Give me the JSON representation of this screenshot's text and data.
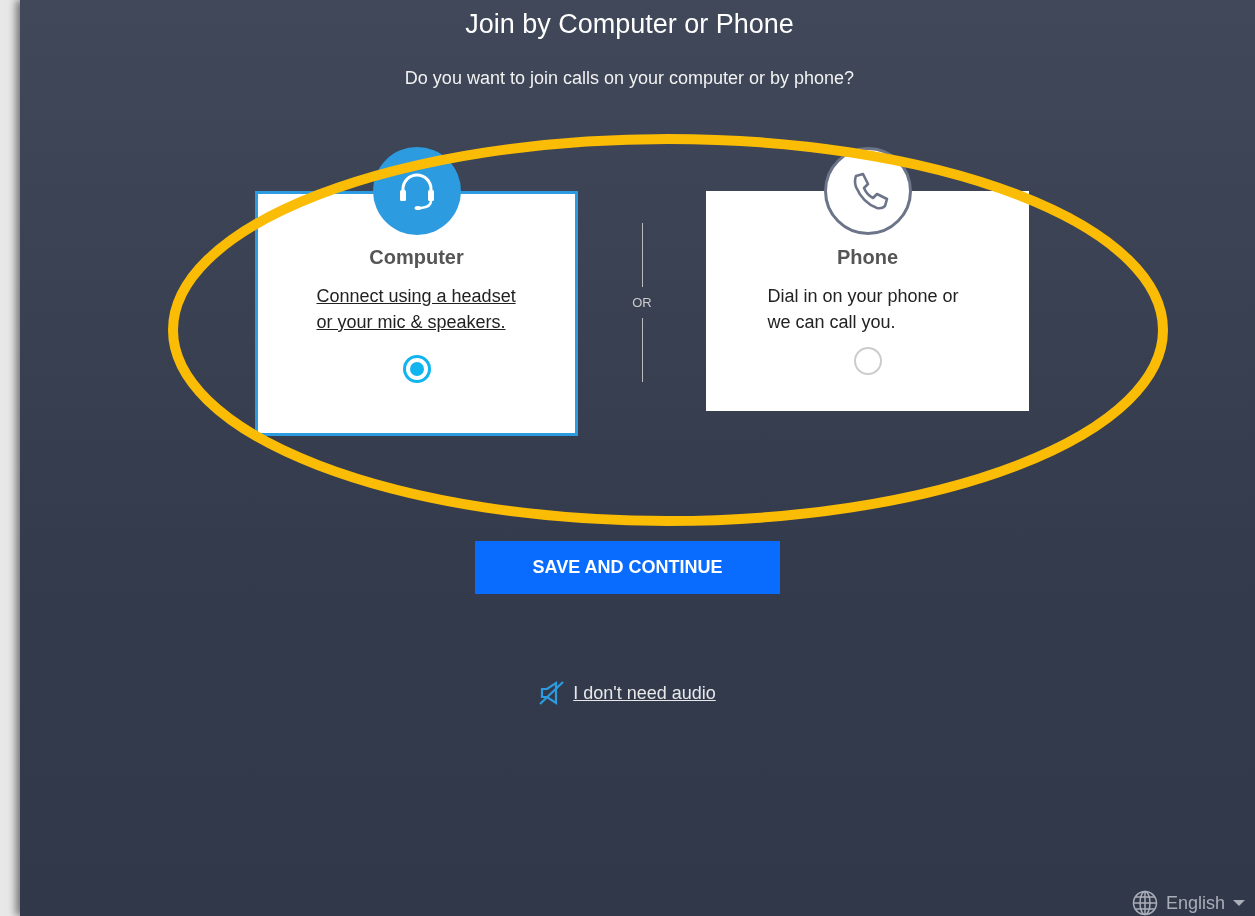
{
  "title": "Join by Computer or Phone",
  "subtitle": "Do you want to join calls on your computer or by phone?",
  "options": [
    {
      "kind": "computer",
      "title": "Computer",
      "description": "Connect using a headset or your mic & speakers.",
      "selected": true
    },
    {
      "kind": "phone",
      "title": "Phone",
      "description": "Dial in on your phone or we can call you.",
      "selected": false
    }
  ],
  "divider_label": "OR",
  "primary_button": "SAVE AND CONTINUE",
  "no_audio_link": "I don't need audio",
  "language": "English"
}
